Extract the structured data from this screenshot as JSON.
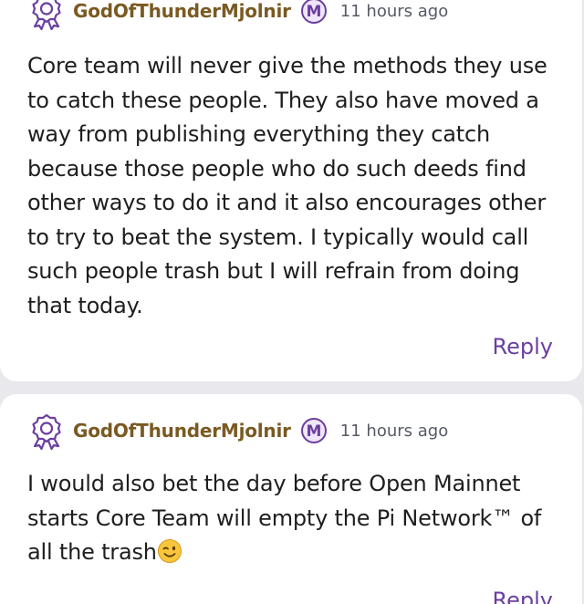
{
  "comments": [
    {
      "username": "GodOfThunderMjolnir",
      "mod_badge": "M",
      "timestamp": "11 hours ago",
      "text": "Core team will never give the methods they use to catch these people. They also have moved a way from publishing everything they catch because those people who do such deeds find other ways to do it and it also encourages other to try to beat the system. I typically would call such people trash but I will refrain from doing that today.",
      "reply_label": "Reply"
    },
    {
      "username": "GodOfThunderMjolnir",
      "mod_badge": "M",
      "timestamp": "11 hours ago",
      "text": "I would also bet the day before Open Mainnet starts Core Team will empty the Pi Network™ of all the trash",
      "reply_label": "Reply"
    }
  ],
  "colors": {
    "username": "#7a5a22",
    "accent": "#6b3fa0",
    "background": "#e9e8ed",
    "card": "#ffffff"
  },
  "icons": {
    "user_badge": "award-ribbon-icon",
    "moderator": "moderator-m-icon",
    "emoji": "winking-face-emoji"
  }
}
